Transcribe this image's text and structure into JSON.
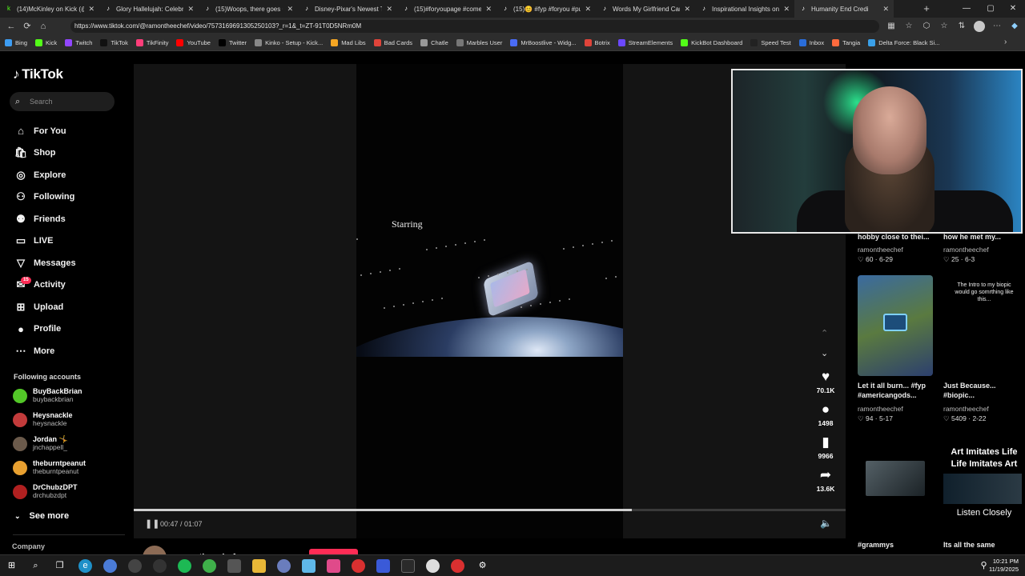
{
  "browser": {
    "tabs": [
      {
        "title": "(14)McKinley on Kick (@m",
        "icon": "k",
        "icon_color": "#53fc18"
      },
      {
        "title": "Glory Hallelujah: Celebrat",
        "icon": "♪",
        "icon_color": "#ffffff"
      },
      {
        "title": "(15)Woops, there goes G",
        "icon": "♪",
        "icon_color": "#ffffff"
      },
      {
        "title": "Disney-Pixar's Newest Tra",
        "icon": "♪",
        "icon_color": "#ffffff"
      },
      {
        "title": "(15)#foryoupage #comed",
        "icon": "♪",
        "icon_color": "#ffffff"
      },
      {
        "title": "(15)😊 #fyp #foryou #pu",
        "icon": "♪",
        "icon_color": "#ffffff"
      },
      {
        "title": "Words My Girlfriend Can't",
        "icon": "♪",
        "icon_color": "#ffffff"
      },
      {
        "title": "Inspirational Insights on C",
        "icon": "♪",
        "icon_color": "#ffffff"
      },
      {
        "title": "Humanity End Credi",
        "icon": "♪",
        "icon_color": "#ffffff"
      }
    ],
    "url": "https://www.tiktok.com/@ramontheechef/video/7573169691305250103?_r=1&_t=ZT-91T0D5NRm0M",
    "bookmarks": [
      {
        "label": "Bing",
        "color": "#3d9df3"
      },
      {
        "label": "Kick",
        "color": "#53fc18"
      },
      {
        "label": "Twitch",
        "color": "#9146ff"
      },
      {
        "label": "TikTok",
        "color": "#111111"
      },
      {
        "label": "TikFinity",
        "color": "#ff3e7a"
      },
      {
        "label": "YouTube",
        "color": "#ff0000"
      },
      {
        "label": "Twitter",
        "color": "#000000"
      },
      {
        "label": "Kinko - Setup - Kick...",
        "color": "#888888"
      },
      {
        "label": "Mad Libs",
        "color": "#f5a623"
      },
      {
        "label": "Bad Cards",
        "color": "#e0443a"
      },
      {
        "label": "Chatle",
        "color": "#999999"
      },
      {
        "label": "Marbles User",
        "color": "#777777"
      },
      {
        "label": "MrBoostlive - Widg...",
        "color": "#4a6cf7"
      },
      {
        "label": "Botrix",
        "color": "#e0443a"
      },
      {
        "label": "StreamElements",
        "color": "#6b48ff"
      },
      {
        "label": "KickBot Dashboard",
        "color": "#53fc18"
      },
      {
        "label": "Speed Test",
        "color": "#222222"
      },
      {
        "label": "Inbox",
        "color": "#2a6dd9"
      },
      {
        "label": "Tangia",
        "color": "#ff6a3d"
      },
      {
        "label": "Delta Force: Black Si...",
        "color": "#3aa0e8"
      }
    ]
  },
  "tiktok": {
    "logo": "TikTok",
    "search_placeholder": "Search",
    "nav": [
      {
        "label": "For You",
        "icon": "⌂"
      },
      {
        "label": "Shop",
        "icon": "🛍"
      },
      {
        "label": "Explore",
        "icon": "◎"
      },
      {
        "label": "Following",
        "icon": "⚇"
      },
      {
        "label": "Friends",
        "icon": "⚉"
      },
      {
        "label": "LIVE",
        "icon": "▭"
      },
      {
        "label": "Messages",
        "icon": "▽"
      },
      {
        "label": "Activity",
        "icon": "✉",
        "badge": "15"
      },
      {
        "label": "Upload",
        "icon": "⊞"
      },
      {
        "label": "Profile",
        "icon": "●"
      },
      {
        "label": "More",
        "icon": "⋯"
      }
    ],
    "following_header": "Following accounts",
    "following": [
      {
        "name": "BuyBackBrian",
        "handle": "buybackbrian",
        "color": "#53c728"
      },
      {
        "name": "Heysnackle",
        "handle": "heysnackle",
        "color": "#c23b3b"
      },
      {
        "name": "Jordan 🤸",
        "handle": "jnchappell_",
        "color": "#6b5a4b"
      },
      {
        "name": "theburntpeanut",
        "handle": "theburntpeanut",
        "color": "#e8a030"
      },
      {
        "name": "DrChubzDPT",
        "handle": "drchubzdpt",
        "color": "#b02020"
      }
    ],
    "see_more": "See more",
    "company": "Company"
  },
  "video": {
    "caption_text": "Starring",
    "time": "00:47 / 01:07",
    "progress_fraction": 0.7,
    "likes": "70.1K",
    "comments": "1498",
    "saves": "9966",
    "shares": "13.6K",
    "author": "ramontheechef"
  },
  "recommended": [
    {
      "title": "hobby close to thei...",
      "user": "ramontheechef",
      "stats": "♡ 60 · 6-29"
    },
    {
      "title": "how he met my...",
      "user": "ramontheechef",
      "stats": "♡ 25 · 6-3"
    },
    {
      "title": "Let it all burn... #fyp #americangods...",
      "user": "ramontheechef",
      "stats": "♡ 94 · 5-17"
    },
    {
      "title": "Just Because... #biopic...",
      "user": "ramontheechef",
      "stats": "♡ 5409 · 2-22",
      "thumb_text": "The Intro to my biopic would go somrthing like this..."
    },
    {
      "title": "#grammys",
      "user": "",
      "stats": ""
    },
    {
      "title": "Its all the same",
      "user": "",
      "stats": "",
      "thumb_text": "Art Imitates Life Life Imitates Art",
      "thumb_text2": "Listen Closely"
    }
  ],
  "taskbar": {
    "time": "10:21 PM",
    "date": "11/19/2025"
  }
}
